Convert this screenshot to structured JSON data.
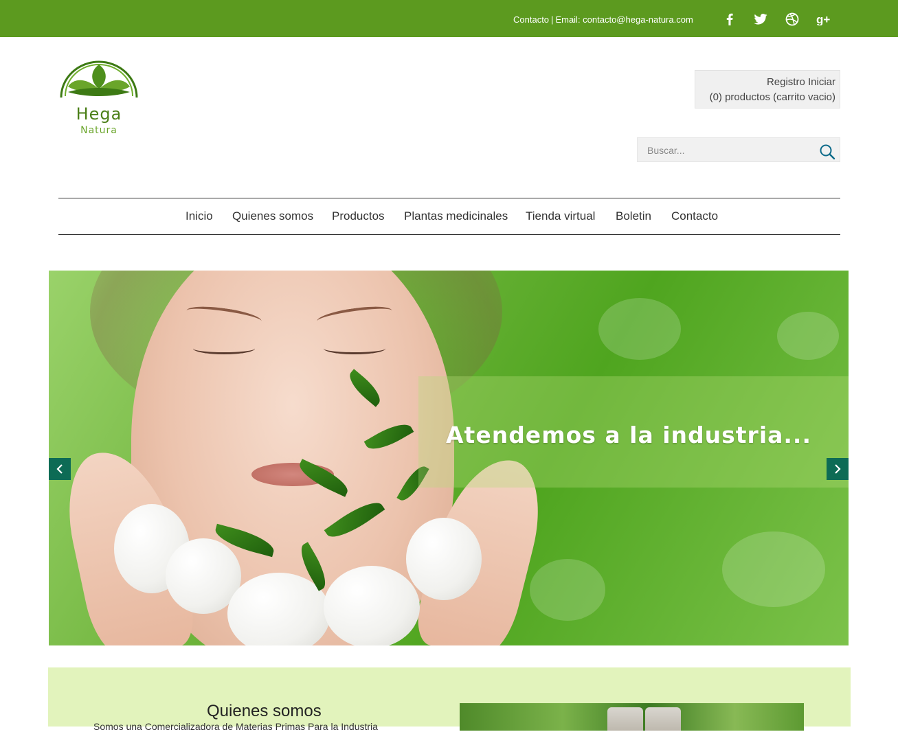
{
  "topbar": {
    "contact_label": "Contacto",
    "separator": "|",
    "email_text": "Email: contacto@hega-natura.com",
    "social": [
      "facebook-icon",
      "twitter-icon",
      "dribbble-icon",
      "google-plus-icon"
    ],
    "bg_color": "#5c9a1f"
  },
  "logo": {
    "line1": "Hega",
    "line2": "Natura"
  },
  "account": {
    "register": "Registro",
    "login": "Iniciar",
    "cart": "(0) productos (carrito vacio)"
  },
  "search": {
    "placeholder": "Buscar..."
  },
  "nav": {
    "items": [
      "Inicio",
      "Quienes somos",
      "Productos",
      "Plantas medicinales",
      "Tienda virtual",
      "Boletin",
      "Contacto"
    ]
  },
  "slider": {
    "caption": "Atendemos a la industria...",
    "accent_color": "#0d6b55"
  },
  "about": {
    "title": "Quienes somos",
    "text": "Somos una Comercializadora de Materias Primas Para la Industria"
  }
}
